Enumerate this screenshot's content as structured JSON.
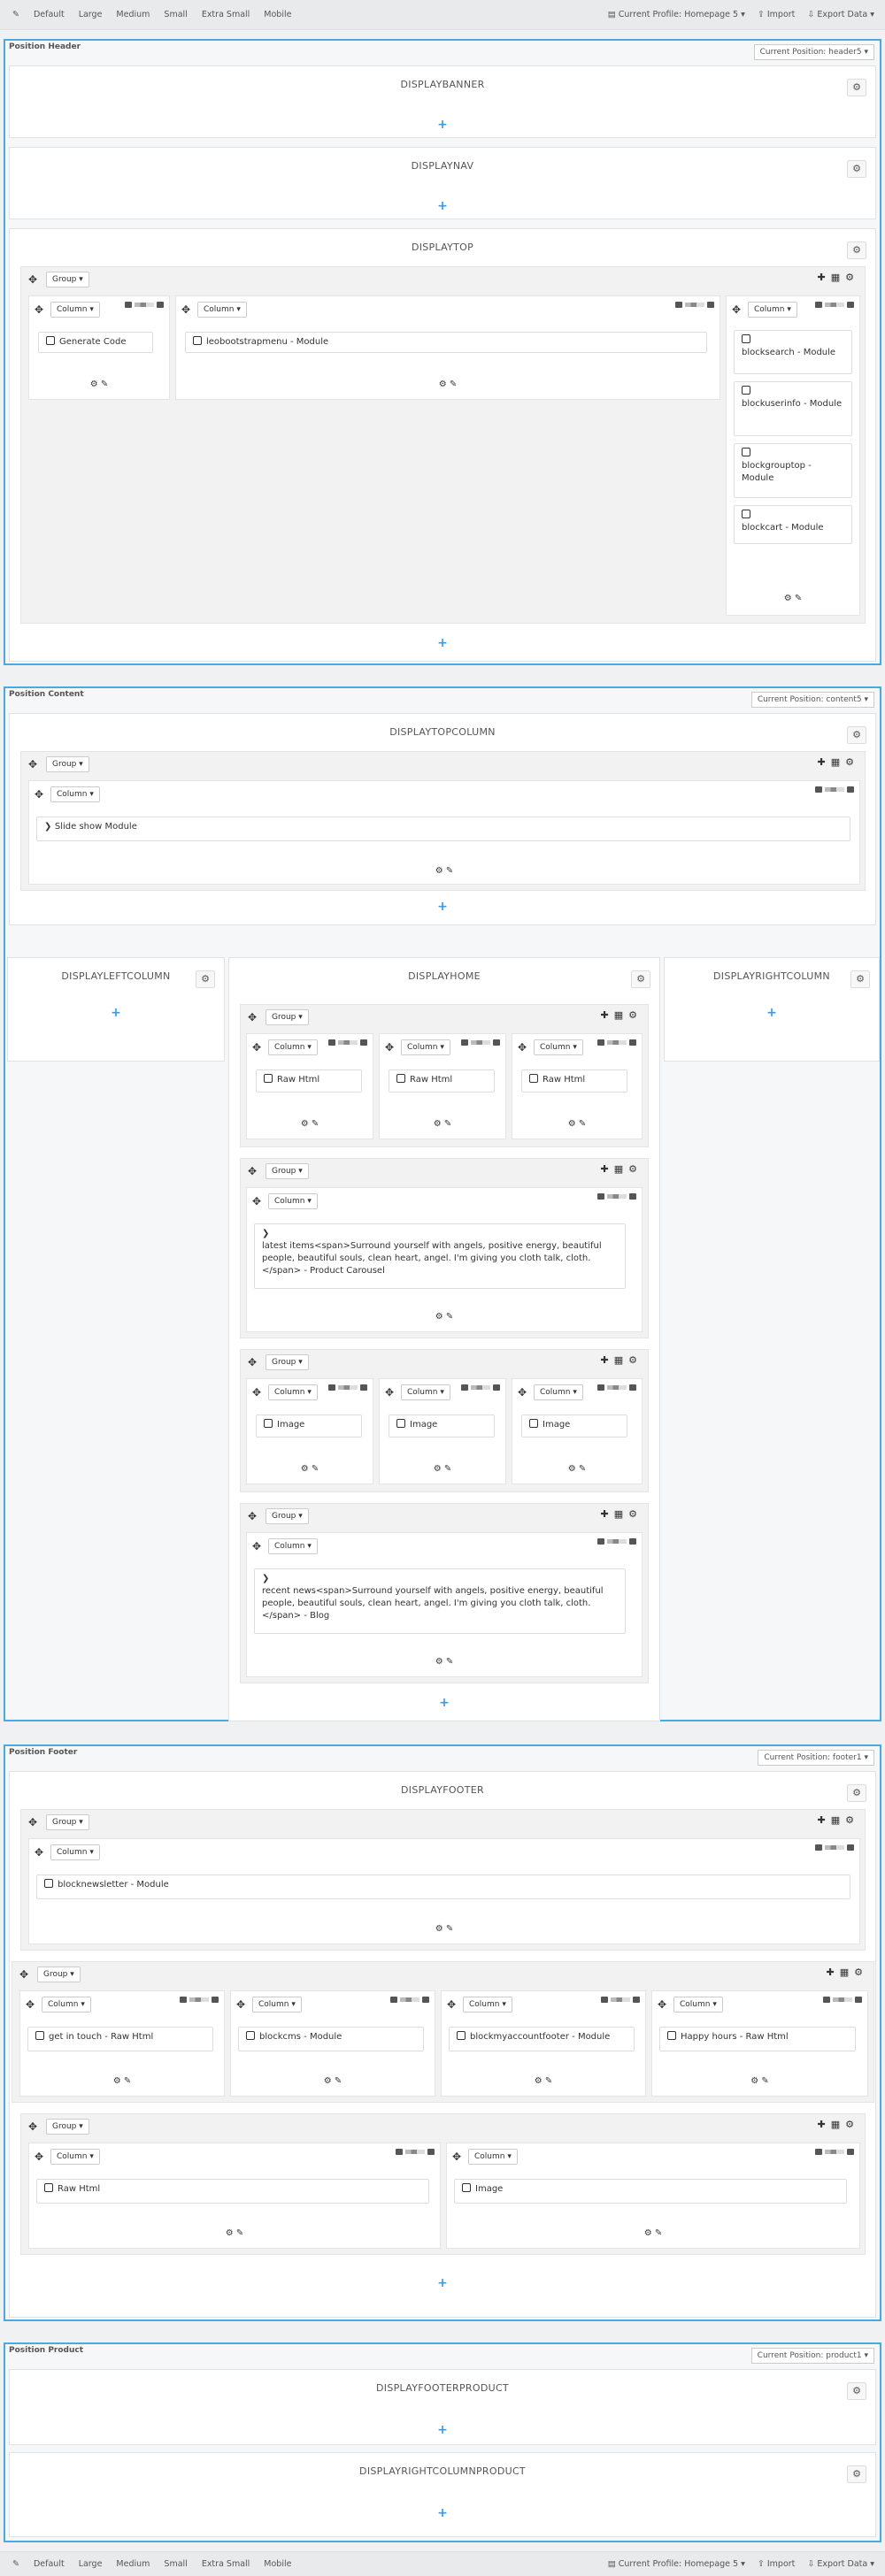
{
  "toolbar": {
    "edit_icon": "pencil-icon",
    "devices": [
      "Default",
      "Large",
      "Medium",
      "Small",
      "Extra Small",
      "Mobile"
    ],
    "profile": "Current Profile: Homepage 5",
    "profile_bottom": "Current Profile: Homepage 5",
    "import": "Import",
    "export": "Export Data"
  },
  "common": {
    "group": "Group",
    "column": "Column",
    "plus": "+"
  },
  "header": {
    "title": "Position Header",
    "current": "Current Position: header5",
    "hooks": [
      "DISPLAYBANNER",
      "DISPLAYNAV",
      "DISPLAYTOP"
    ],
    "widgets": {
      "generate": "Generate Code",
      "menu": "leobootstrapmenu - Module",
      "search": "blocksearch - Module",
      "userinfo": "blockuserinfo - Module",
      "grouptop": "blockgrouptop - Module",
      "cart": "blockcart - Module"
    }
  },
  "content": {
    "title": "Position Content",
    "current": "Current Position: content5",
    "hooks": {
      "topcolumn": "DISPLAYTOPCOLUMN",
      "left": "DISPLAYLEFTCOLUMN",
      "home": "DISPLAYHOME",
      "right": "DISPLAYRIGHTCOLUMN"
    },
    "widgets": {
      "slideshow": "Slide show Module",
      "raw_html": "Raw Html",
      "carousel": "latest items<span>Surround yourself with angels, positive energy, beautiful people, beautiful souls, clean heart, angel. I'm giving you cloth talk, cloth.</span> - Product Carousel",
      "image": "Image",
      "blog": "recent news<span>Surround yourself with angels, positive energy, beautiful people, beautiful souls, clean heart, angel. I'm giving you cloth talk, cloth.</span> - Blog"
    }
  },
  "footer": {
    "title": "Position Footer",
    "current": "Current Position: footer1",
    "hook": "DISPLAYFOOTER",
    "widgets": {
      "newsletter": "blocknewsletter - Module",
      "getintouch": "get in touch - Raw Html",
      "cms": "blockcms - Module",
      "myaccount": "blockmyaccountfooter - Module",
      "hours": "Happy hours - Raw Html",
      "raw_html": "Raw Html",
      "image": "Image"
    }
  },
  "product": {
    "title": "Position Product",
    "current": "Current Position: product1",
    "hooks": [
      "DISPLAYFOOTERPRODUCT",
      "DISPLAYRIGHTCOLUMNPRODUCT"
    ]
  },
  "colors": {
    "accent": "#4aa9e0",
    "plus": "#3c9be0"
  }
}
